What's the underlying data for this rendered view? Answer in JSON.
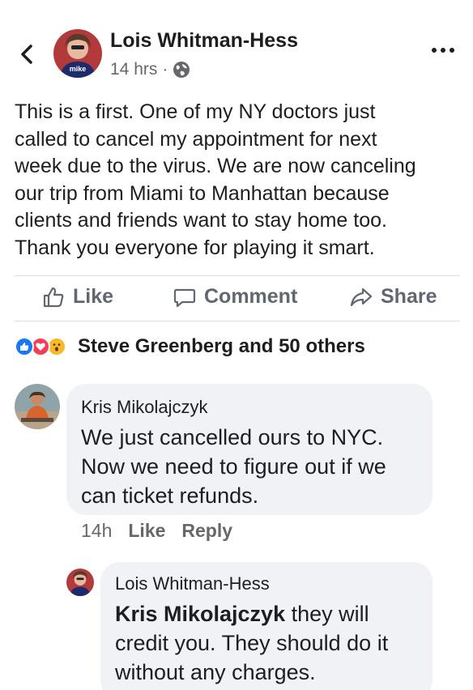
{
  "post": {
    "author": "Lois Whitman-Hess",
    "time": "14 hrs",
    "separator": "·",
    "avatar_caption": "mike",
    "text": "This is a first. One of my NY doctors just\ncalled to cancel my appointment  for next\nweek due to the virus. We are now canceling\nour trip from Miami to Manhattan because\nclients and friends want to stay home too.\nThank you everyone for playing it smart."
  },
  "actions": {
    "like": "Like",
    "comment": "Comment",
    "share": "Share"
  },
  "reactions": {
    "icons": [
      "like-reaction-icon",
      "love-reaction-icon",
      "wow-reaction-icon"
    ],
    "summary": "Steve Greenberg and 50 others"
  },
  "comments": [
    {
      "author": "Kris Mikolajczyk",
      "text": "We just cancelled ours to NYC.\nNow we need to figure out if we\ncan ticket refunds.",
      "time": "14h",
      "like": "Like",
      "reply": "Reply"
    }
  ],
  "reply": {
    "author": "Lois Whitman-Hess",
    "mention": "Kris Mikolajczyk",
    "text_line1_rest": " they will",
    "text_rest": "credit you. They should do it\nwithout any charges."
  },
  "colors": {
    "text": "#1c1e21",
    "secondary": "#65676b",
    "action": "#606770",
    "bubble": "#f0f2f5",
    "like_blue": "#1877f2",
    "love_red": "#f33e58",
    "wow_yellow": "#f7b928"
  }
}
